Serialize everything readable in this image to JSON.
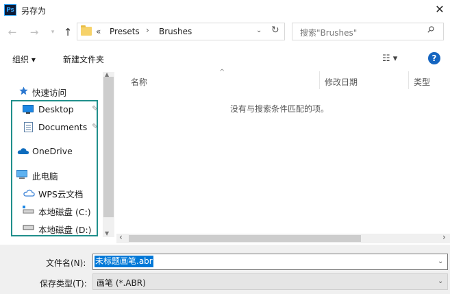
{
  "window": {
    "title": "另存为",
    "app_icon_text": "Ps"
  },
  "nav": {
    "crumb_overflow": "«",
    "breadcrumbs": [
      "Presets",
      "Brushes"
    ],
    "search_placeholder": "搜索\"Brushes\""
  },
  "toolbar": {
    "organize": "组织 ▾",
    "new_folder": "新建文件夹",
    "help": "?"
  },
  "sidebar": {
    "items": [
      {
        "label": "快速访问",
        "icon": "star-icon"
      },
      {
        "label": "Desktop",
        "icon": "desktop-icon",
        "pinned": true
      },
      {
        "label": "Documents",
        "icon": "document-icon",
        "pinned": true
      },
      {
        "label": "OneDrive",
        "icon": "cloud-icon"
      },
      {
        "label": "此电脑",
        "icon": "computer-icon"
      },
      {
        "label": "WPS云文档",
        "icon": "wps-cloud-icon"
      },
      {
        "label": "本地磁盘 (C:)",
        "icon": "drive-icon"
      },
      {
        "label": "本地磁盘 (D:)",
        "icon": "drive-icon"
      }
    ],
    "highlight_color": "#1f8f8b"
  },
  "list": {
    "columns": [
      "名称",
      "修改日期",
      "类型"
    ],
    "empty_message": "没有与搜索条件匹配的项。"
  },
  "form": {
    "filename_label": "文件名(N):",
    "filename_value": "未标题画笔.abr",
    "filetype_label": "保存类型(T):",
    "filetype_value": "画笔 (*.ABR)"
  },
  "colors": {
    "accent": "#0078d7",
    "help": "#1565c0",
    "folder": "#f6d26a"
  }
}
